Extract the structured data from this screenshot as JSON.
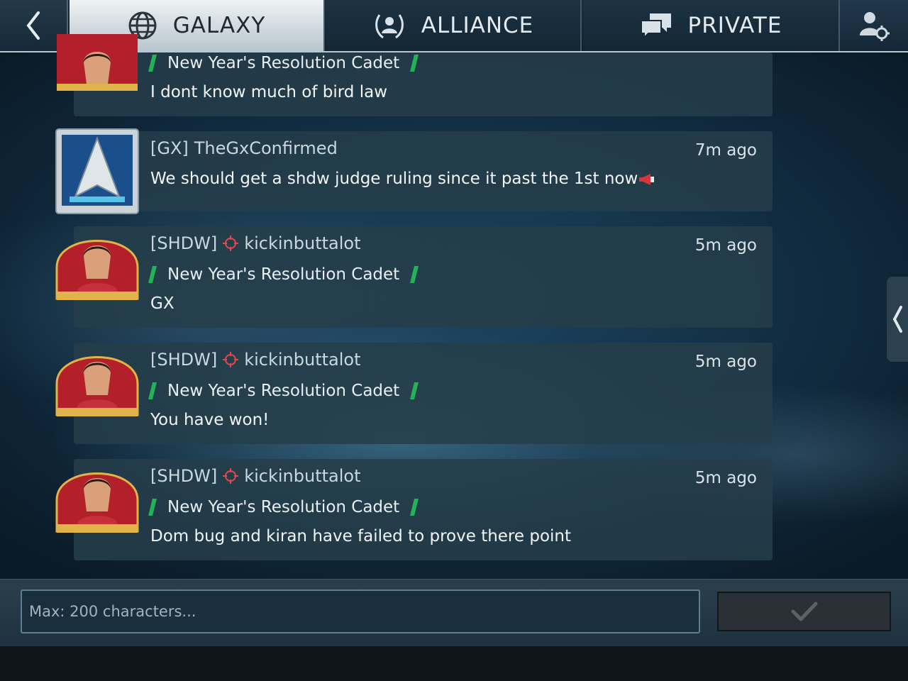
{
  "header": {
    "tabs": [
      {
        "label": "GALAXY",
        "icon": "globe-icon",
        "active": true
      },
      {
        "label": "ALLIANCE",
        "icon": "alliance-laurel-icon",
        "active": false
      },
      {
        "label": "PRIVATE",
        "icon": "chat-bubbles-icon",
        "active": false
      }
    ],
    "back_icon": "chevron-left-icon",
    "settings_icon": "user-settings-icon"
  },
  "messages": [
    {
      "title": "New Year's Resolution Cadet",
      "text": "I dont know much of bird law"
    },
    {
      "tag": "[GX]",
      "user": "TheGxConfirmed",
      "time": "7m ago",
      "text": "We should get a shdw judge ruling since it past the 1st now"
    },
    {
      "tag": "[SHDW]",
      "user": "kickinbuttalot",
      "time": "5m ago",
      "title": "New Year's Resolution Cadet",
      "text": "GX"
    },
    {
      "tag": "[SHDW]",
      "user": "kickinbuttalot",
      "time": "5m ago",
      "title": "New Year's Resolution Cadet",
      "text": "You have won!"
    },
    {
      "tag": "[SHDW]",
      "user": "kickinbuttalot",
      "time": "5m ago",
      "title": "New Year's Resolution Cadet",
      "text": "Dom bug and kiran have failed to prove there point"
    }
  ],
  "composer": {
    "placeholder": "Max: 200 characters...",
    "value": ""
  },
  "colors": {
    "accent_green": "#22b357",
    "target_red": "#e2484c",
    "active_tab": "#e3e9ed"
  }
}
